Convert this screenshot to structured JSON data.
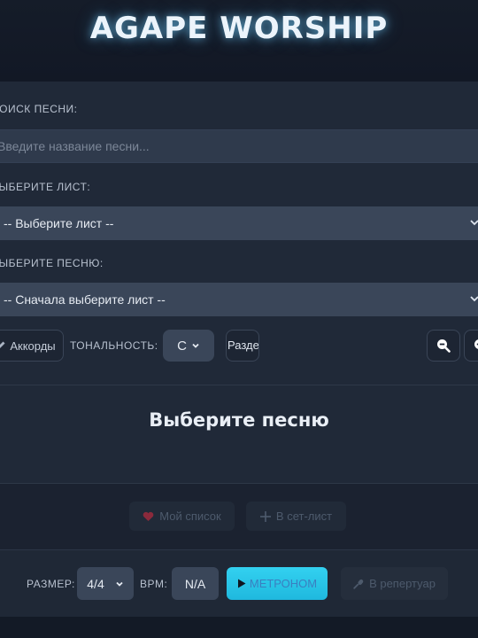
{
  "app": {
    "title": "AGAPE WORSHIP"
  },
  "search": {
    "label": "Поиск песни:",
    "placeholder": "Введите название песни...",
    "value": ""
  },
  "sheet_select": {
    "label": "Выберите лист:",
    "selected": "-- Выберите лист --"
  },
  "song_select": {
    "label": "Выберите песню:",
    "selected": "-- Сначала выберите лист --"
  },
  "controls": {
    "chords_button": "Аккорды",
    "key_label": "ТОНАЛЬНОСТЬ:",
    "key_value": "C",
    "sections_button": "Разделы"
  },
  "song_display": {
    "placeholder": "Выберите песню"
  },
  "actions": {
    "favorites_button": "Мой список",
    "setlist_button": "В сет-лист"
  },
  "footer": {
    "time_signature_label": "РАЗМЕР:",
    "time_signature_value": "4/4",
    "bpm_label": "BPM:",
    "bpm_value": "N/A",
    "metronome_button": "МЕТРОНОМ",
    "repertoire_button": "В репертуар"
  },
  "icons": {
    "chords": "pencil-icon",
    "key_dropdown": "chevron-down-icon",
    "zoom_out": "zoom-out-icon",
    "zoom_in": "zoom-in-icon",
    "favorites": "heart-icon",
    "setlist": "plus-icon",
    "metronome": "play-icon",
    "repertoire": "microphone-icon"
  },
  "colors": {
    "accent": "#22c1e6",
    "heart": "#8b2a3c",
    "background": "#131a26",
    "panel": "#202938"
  }
}
